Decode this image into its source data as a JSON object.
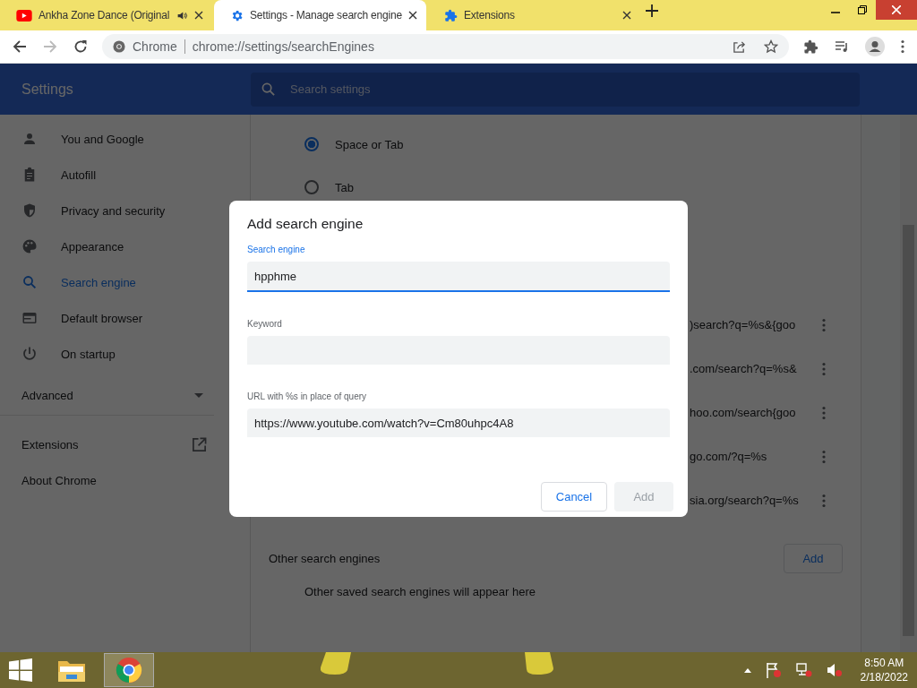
{
  "tabs": [
    {
      "title": "Ankha Zone Dance (Original",
      "audio": true,
      "selected": false
    },
    {
      "title": "Settings - Manage search engine",
      "audio": false,
      "selected": true
    },
    {
      "title": "Extensions",
      "audio": false,
      "selected": false
    }
  ],
  "address_bar": {
    "site": "Chrome",
    "url": "chrome://settings/searchEngines"
  },
  "header": {
    "title": "Settings",
    "search_placeholder": "Search settings"
  },
  "sidebar": {
    "items": [
      {
        "label": "You and Google",
        "selected": false
      },
      {
        "label": "Autofill",
        "selected": false
      },
      {
        "label": "Privacy and security",
        "selected": false
      },
      {
        "label": "Appearance",
        "selected": false
      },
      {
        "label": "Search engine",
        "selected": true
      },
      {
        "label": "Default browser",
        "selected": false
      },
      {
        "label": "On startup",
        "selected": false
      }
    ],
    "advanced": "Advanced",
    "links": [
      "Extensions",
      "About Chrome"
    ]
  },
  "shortcut_options": [
    {
      "label": "Space or Tab",
      "selected": true
    },
    {
      "label": "Tab",
      "selected": false
    }
  ],
  "engine_rows": [
    {
      "url": ")search?q=%s&{goo"
    },
    {
      "url": ".com/search?q=%s&"
    },
    {
      "url": "hoo.com/search{goo"
    },
    {
      "url": "go.com/?q=%s"
    },
    {
      "url": "sia.org/search?q=%s"
    }
  ],
  "other_engines": {
    "title": "Other search engines",
    "add_button": "Add",
    "empty_text": "Other saved search engines will appear here"
  },
  "dialog": {
    "title": "Add search engine",
    "fields": [
      {
        "label": "Search engine",
        "value": "hpphme",
        "focused": true
      },
      {
        "label": "Keyword",
        "focused": false
      },
      {
        "label": "URL with %s in place of query",
        "value": "https://www.youtube.com/watch?v=Cm80uhpc4A8",
        "focused": false
      }
    ],
    "cancel": "Cancel",
    "add": "Add",
    "add_disabled": true
  },
  "taskbar": {
    "apps": [
      {
        "selected": false
      },
      {
        "selected": true
      }
    ],
    "time": "8:50 AM",
    "date": "2/18/2022"
  }
}
